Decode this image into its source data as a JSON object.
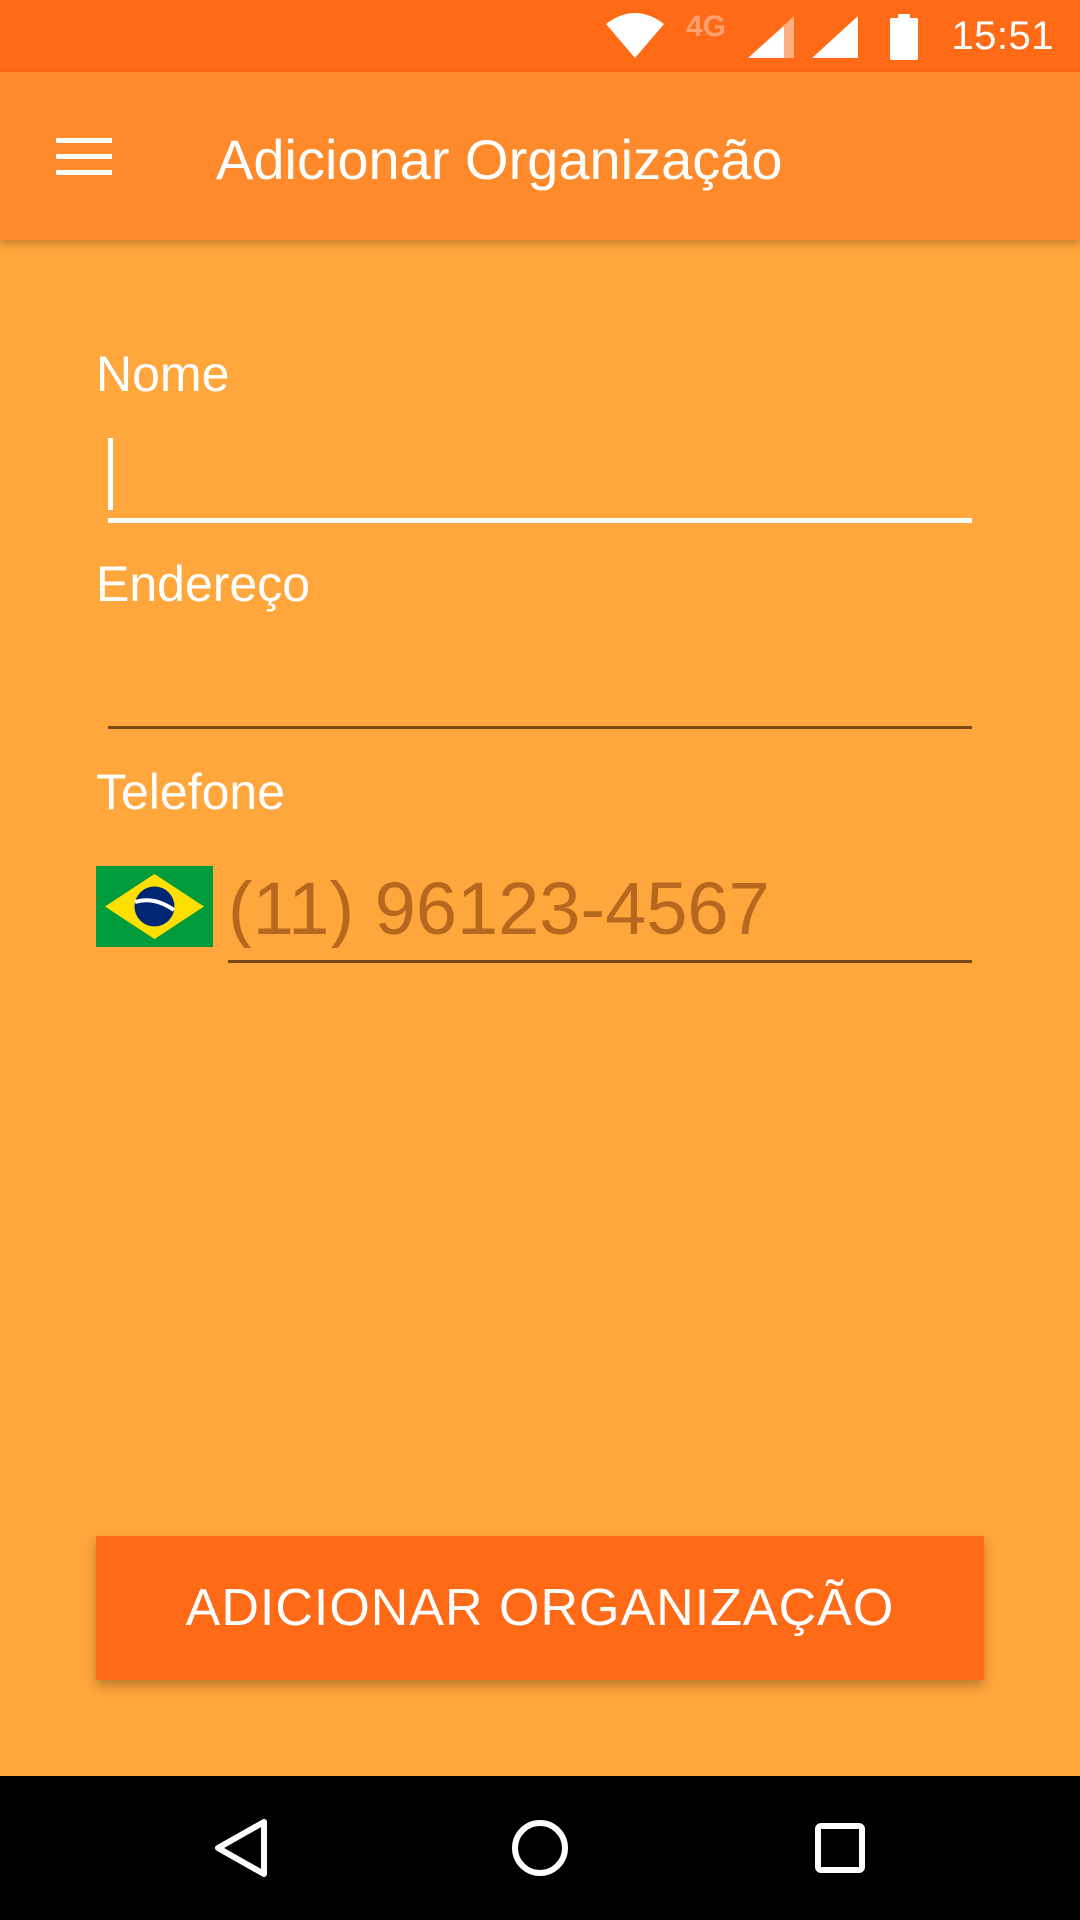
{
  "status_bar": {
    "time": "15:51",
    "network_label": "4G",
    "icons": [
      "wifi-icon",
      "signal-icon",
      "signal-icon",
      "battery-icon"
    ]
  },
  "app_bar": {
    "title": "Adicionar Organização",
    "menu_icon": "hamburger-menu-icon"
  },
  "form": {
    "nome": {
      "label": "Nome",
      "value": ""
    },
    "endereco": {
      "label": "Endereço",
      "value": ""
    },
    "telefone": {
      "label": "Telefone",
      "country_flag": "brazil-flag-icon",
      "value": "",
      "placeholder": "(11) 96123-4567"
    }
  },
  "actions": {
    "submit_label": "ADICIONAR ORGANIZAÇÃO"
  },
  "navigation": {
    "icons": [
      "back-icon",
      "home-icon",
      "recents-icon"
    ]
  },
  "colors": {
    "status_bar": "#FF6A17",
    "app_bar": "#FF8A2B",
    "background": "#FFA63C",
    "button": "#FF6A17",
    "placeholder": "#B6681E"
  }
}
